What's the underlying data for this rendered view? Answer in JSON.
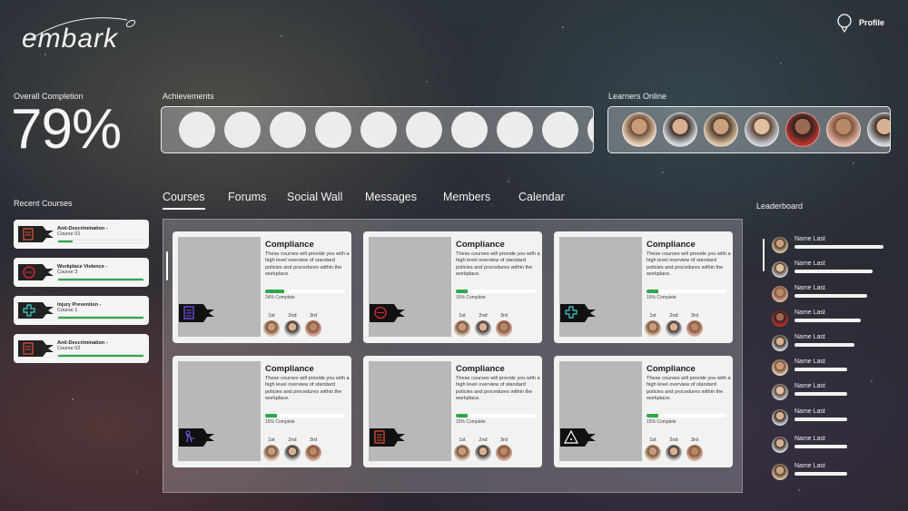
{
  "app": {
    "logo_text": "embark",
    "profile_label": "Profile"
  },
  "overall": {
    "label": "Overall Completion",
    "value": "79%"
  },
  "achievements": {
    "label": "Achievements",
    "badge_count": 10
  },
  "learners": {
    "label": "Learners Online"
  },
  "recent": {
    "label": "Recent Courses",
    "items": [
      {
        "title": "Anti-Descrimination -",
        "sub": "Course 01",
        "progress": 0.17,
        "icon": "document-icon",
        "color": "#e8533a"
      },
      {
        "title": "Workplace Violence -",
        "sub": "Course 3",
        "progress": 1.0,
        "icon": "fist-icon",
        "color": "#e0283c"
      },
      {
        "title": "Injury Prevention -",
        "sub": "Course 1",
        "progress": 1.0,
        "icon": "medical-cross-icon",
        "color": "#3fd3d1"
      },
      {
        "title": "Anti-Descrimination -",
        "sub": "Course 02",
        "progress": 1.0,
        "icon": "document-icon",
        "color": "#e8533a"
      }
    ]
  },
  "tabs": [
    "Courses",
    "Forums",
    "Social Wall",
    "Messages",
    "Members",
    "Calendar"
  ],
  "courses": [
    {
      "title": "Compliance",
      "desc": "These courses will provide you with a high level overview of standard policies and procedures within the workplace.",
      "progress": 0.24,
      "pct_text": "24% Complete",
      "icon": "document-icon",
      "color": "#7a55ff"
    },
    {
      "title": "Compliance",
      "desc": "These courses will provide you with a high level overview of standard policies and procedures within the workplace.",
      "progress": 0.15,
      "pct_text": "15% Complete",
      "icon": "fist-icon",
      "color": "#e0283c"
    },
    {
      "title": "Compliance",
      "desc": "These courses will provide you with a high level overview of standard policies and procedures within the workplace.",
      "progress": 0.15,
      "pct_text": "15% Complete",
      "icon": "medical-cross-icon",
      "color": "#3fd3d1"
    },
    {
      "title": "Compliance",
      "desc": "These courses will provide you with a high level overview of standard policies and procedures within the workplace.",
      "progress": 0.15,
      "pct_text": "15% Complete",
      "icon": "worker-icon",
      "color": "#6a6aff"
    },
    {
      "title": "Compliance",
      "desc": "These courses will provide you with a high level overview of standard policies and procedures within the workplace.",
      "progress": 0.15,
      "pct_text": "15% Complete",
      "icon": "document-icon",
      "color": "#e8533a"
    },
    {
      "title": "Compliance",
      "desc": "These courses will provide you with a high level overview of standard policies and procedures within the workplace.",
      "progress": 0.15,
      "pct_text": "15% Complete",
      "icon": "hazard-icon",
      "color": "#ffffff"
    }
  ],
  "ranks": [
    "1st",
    "2nd",
    "3rd"
  ],
  "leaderboard": {
    "label": "Leaderboard",
    "entries": [
      {
        "name": "Name Last",
        "score": 1.0
      },
      {
        "name": "Name Last",
        "score": 0.88
      },
      {
        "name": "Name Last",
        "score": 0.82
      },
      {
        "name": "Name Last",
        "score": 0.74
      },
      {
        "name": "Name Last",
        "score": 0.67
      },
      {
        "name": "Name Last",
        "score": 0.59
      },
      {
        "name": "Name Last",
        "score": 0.59
      },
      {
        "name": "Name Last",
        "score": 0.59
      },
      {
        "name": "Name Last",
        "score": 0.59
      },
      {
        "name": "Name Last",
        "score": 0.59
      }
    ]
  }
}
